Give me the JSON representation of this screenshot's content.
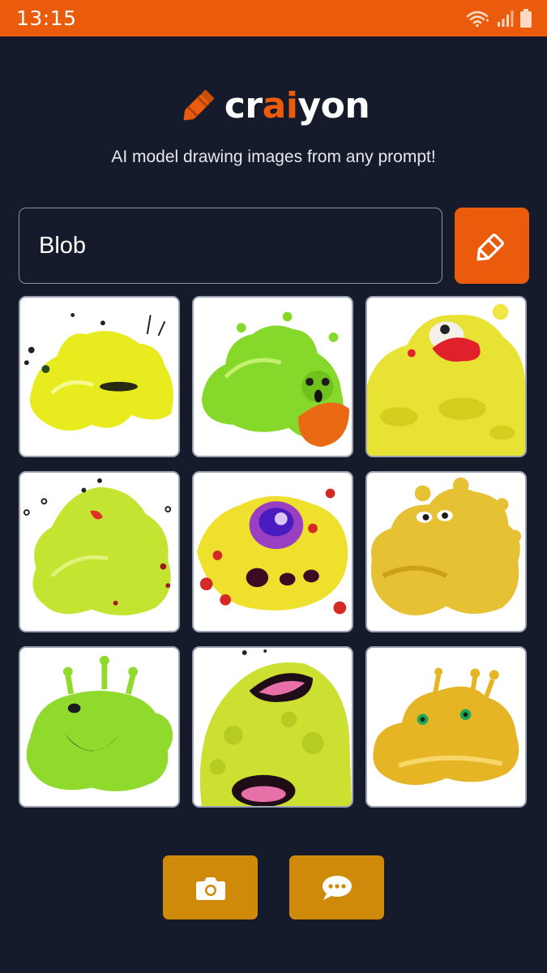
{
  "status_bar": {
    "time": "13:15",
    "icons": [
      "wifi-icon",
      "signal-icon",
      "battery-icon"
    ]
  },
  "logo": {
    "parts": [
      "cr",
      "ai",
      "yon"
    ],
    "icon": "crayon-icon"
  },
  "tagline": "AI model drawing images from any prompt!",
  "prompt": {
    "value": "Blob"
  },
  "draw_button": {
    "icon": "crayon-icon"
  },
  "images": [
    {
      "label": "yellow splash blob"
    },
    {
      "label": "green blob with face"
    },
    {
      "label": "yellow blob with red mouth"
    },
    {
      "label": "green smiling blob"
    },
    {
      "label": "yellow spotted blob with purple face"
    },
    {
      "label": "golden tentacle blob"
    },
    {
      "label": "green antenna blob grinning"
    },
    {
      "label": "lime blob with open mouth"
    },
    {
      "label": "golden puddle blob with green eyes"
    }
  ],
  "bottom_buttons": [
    {
      "icon": "camera-icon"
    },
    {
      "icon": "chat-icon"
    }
  ],
  "colors": {
    "background": "#151b2a",
    "brand_orange": "#ea5b0c",
    "button_gold": "#cf8a0a",
    "border": "#8a93a6"
  }
}
